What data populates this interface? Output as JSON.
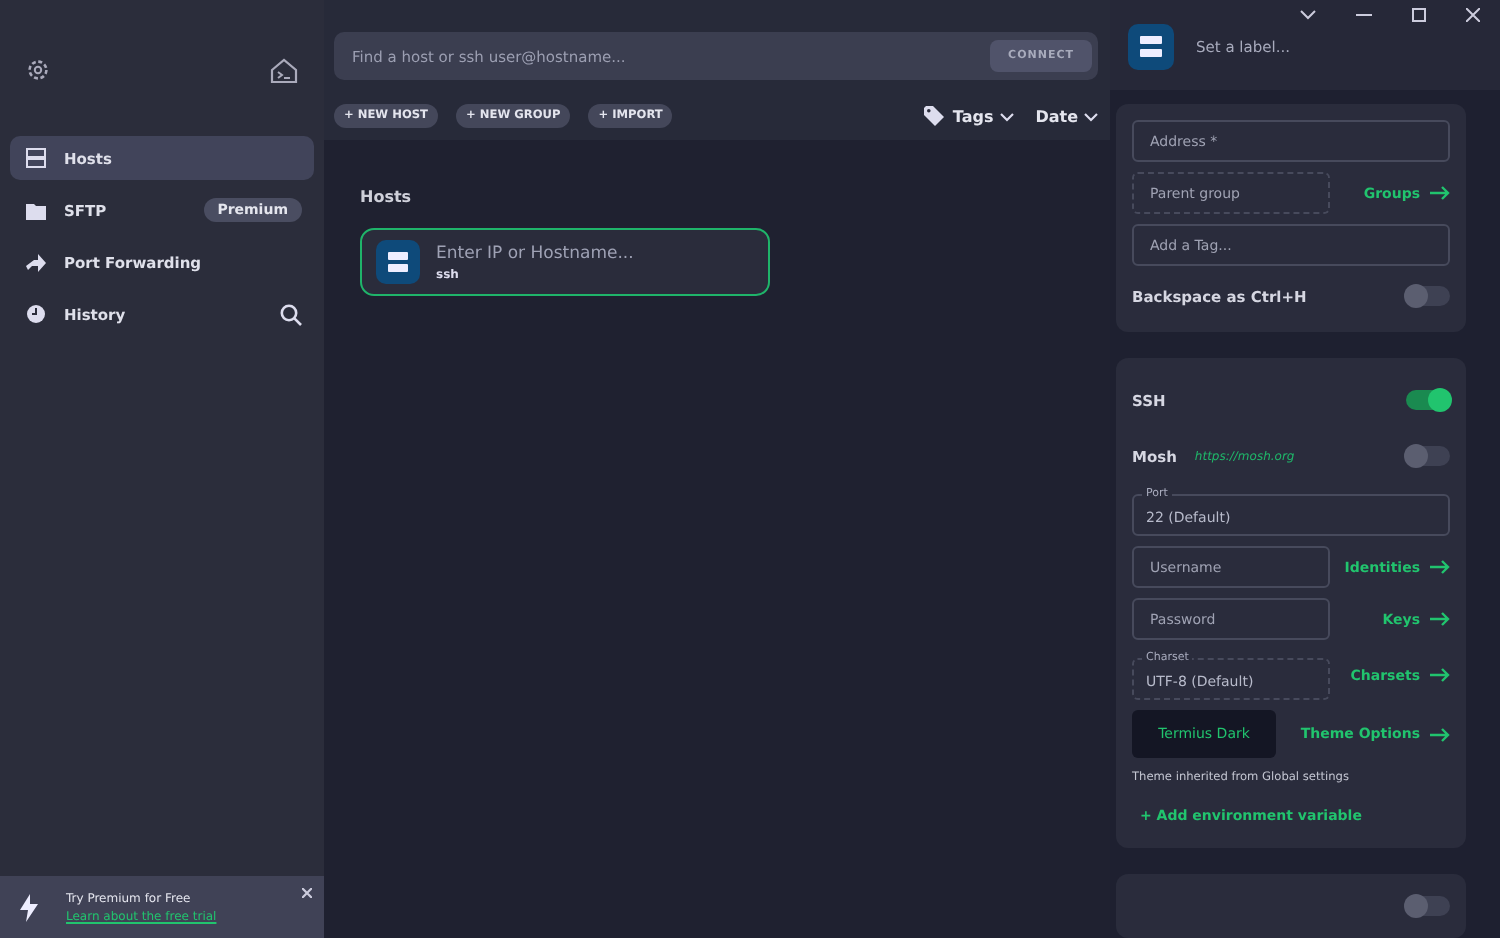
{
  "sidebar": {
    "items": [
      {
        "label": "Hosts",
        "selected": true
      },
      {
        "label": "SFTP",
        "selected": false,
        "badge": "Premium"
      },
      {
        "label": "Port Forwarding",
        "selected": false
      },
      {
        "label": "History",
        "selected": false
      }
    ],
    "promo": {
      "title": "Try Premium for Free",
      "link": "Learn about the free trial"
    }
  },
  "search": {
    "placeholder": "Find a host or ssh user@hostname...",
    "button": "CONNECT"
  },
  "toolbar": {
    "buttons": [
      "+ NEW HOST",
      "+ NEW GROUP",
      "+ IMPORT"
    ],
    "sorts": [
      "Tags",
      "Date"
    ]
  },
  "hosts": {
    "heading": "Hosts",
    "items": [
      {
        "title": "Enter IP or Hostname...",
        "subtitle": "ssh",
        "selected": true
      }
    ]
  },
  "editor": {
    "label_placeholder": "Set a label...",
    "general": {
      "address_placeholder": "Address *",
      "group_placeholder": "Parent group",
      "groups_link": "Groups",
      "tag_placeholder": "Add a Tag...",
      "backspace": {
        "label": "Backspace as Ctrl+H",
        "on": false
      }
    },
    "ssh": {
      "label": "SSH",
      "on": true,
      "mosh": {
        "label": "Mosh",
        "link": "https://mosh.org",
        "on": false
      },
      "port": {
        "legend": "Port",
        "value": "22 (Default)"
      },
      "username_placeholder": "Username",
      "identities_link": "Identities",
      "password_placeholder": "Password",
      "keys_link": "Keys",
      "charset": {
        "legend": "Charset",
        "value": "UTF-8 (Default)"
      },
      "charsets_link": "Charsets",
      "theme": "Termius Dark",
      "theme_link": "Theme Options",
      "theme_note": "Theme inherited from Global settings",
      "env_link": "+ Add environment variable"
    },
    "next_card": {
      "on": false
    }
  }
}
